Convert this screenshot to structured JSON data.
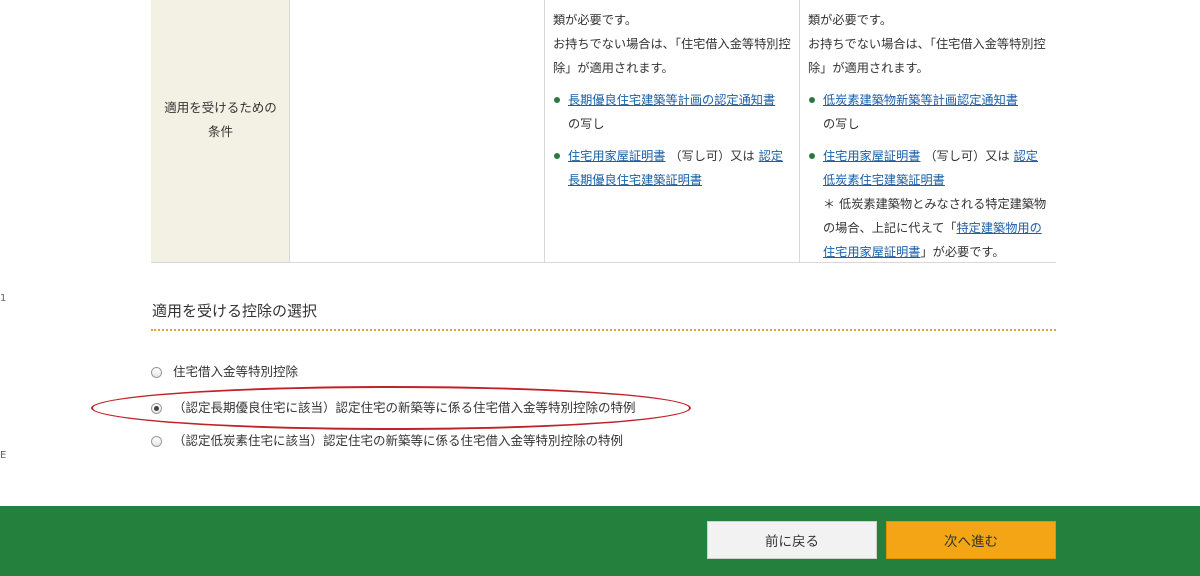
{
  "conditions": {
    "label": "適用を受けるための条件",
    "col1": {
      "intro_lines": [
        "類が必要です。",
        "お持ちでない場合は、「住宅借入金等特別控除」が適用されます。"
      ],
      "item1_link": "長期優良住宅建築等計画の認定通知書",
      "item1_suffix": "の写し",
      "item2_link_a": "住宅用家屋証明書",
      "item2_middle": "（写し可）又は",
      "item2_link_b": "認定長期優良住宅建築証明書"
    },
    "col2": {
      "intro_lines": [
        "類が必要です。",
        "お持ちでない場合は、「住宅借入金等特別控除」が適用されます。"
      ],
      "item1_link": "低炭素建築物新築等計画認定通知書",
      "item1_suffix": "の写し",
      "item2_link_a": "住宅用家屋証明書",
      "item2_middle": "（写し可）又は",
      "item2_link_b": "認定低炭素住宅建築証明書",
      "note_prefix": "＊ 低炭素建築物とみなされる特定建築物の場合、上記に代えて「",
      "note_link": "特定建築物用の住宅用家屋証明書",
      "note_suffix": "」が必要です。"
    }
  },
  "selection": {
    "heading": "適用を受ける控除の選択",
    "options": [
      {
        "label": "住宅借入金等特別控除",
        "checked": false
      },
      {
        "label": "（認定長期優良住宅に該当）認定住宅の新築等に係る住宅借入金等特別控除の特例",
        "checked": true
      },
      {
        "label": "（認定低炭素住宅に該当）認定住宅の新築等に係る住宅借入金等特別控除の特例",
        "checked": false
      }
    ],
    "highlight_color": "#c0222a"
  },
  "footer": {
    "back_label": "前に戻る",
    "next_label": "次へ進む",
    "bg_color": "#24813d",
    "next_color": "#f3a515"
  },
  "edge_marks": [
    "1",
    "E"
  ]
}
